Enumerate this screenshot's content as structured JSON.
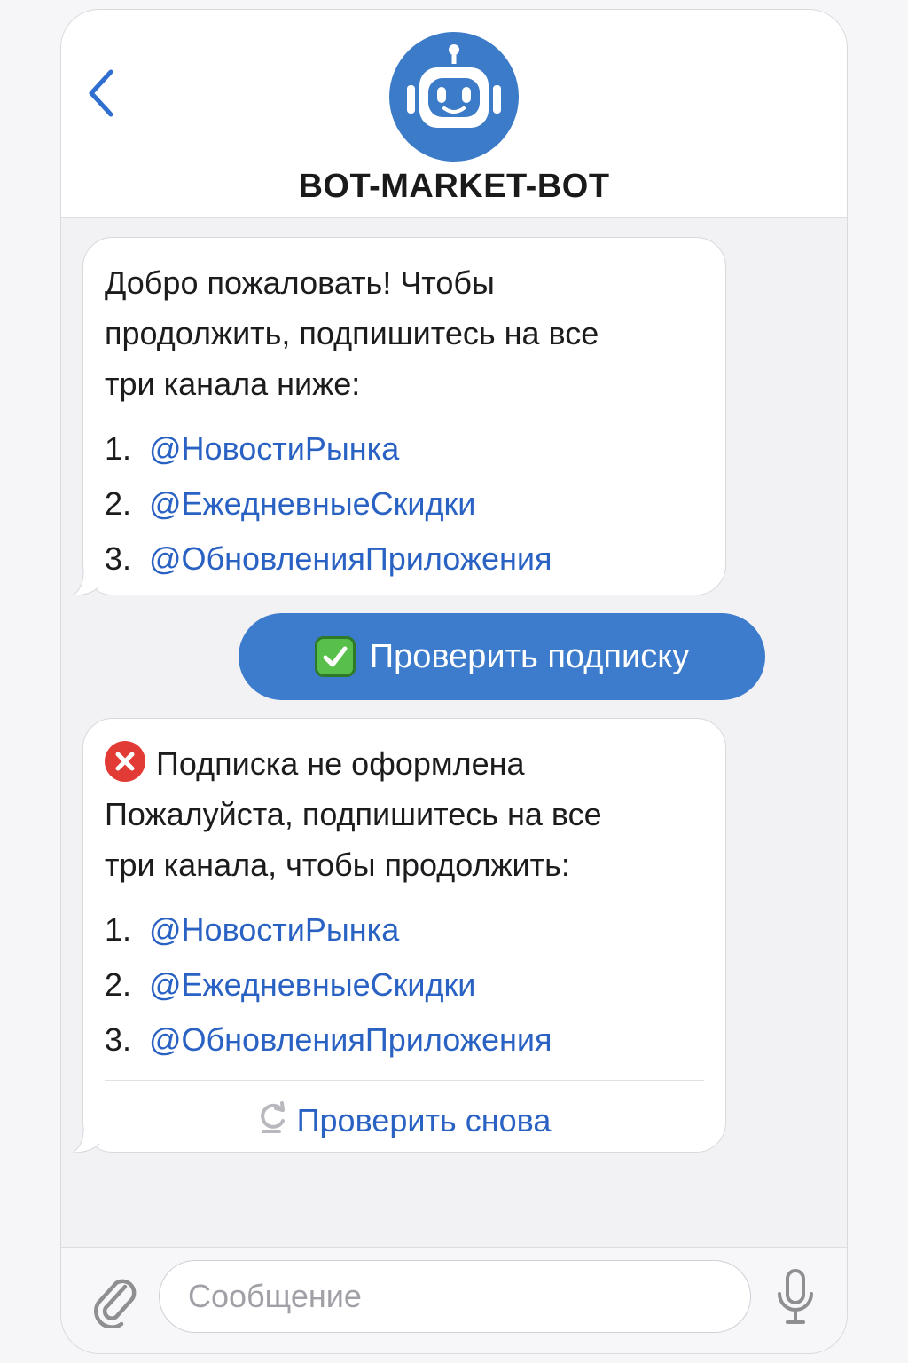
{
  "header": {
    "bot_name": "BOT-MARKET-BOT",
    "back_icon": "chevron-left-icon",
    "avatar_icon": "robot-icon",
    "accent_color": "#3b7bc8"
  },
  "welcome_message": {
    "lines": [
      "Добро пожаловать! Чтобы",
      "продолжить, подпишитесь на все",
      "три канала ниже:"
    ],
    "channels": [
      {
        "num": "1.",
        "name": "@НовостиРынка"
      },
      {
        "num": "2.",
        "name": "@ЕжедневныеСкидки"
      },
      {
        "num": "3.",
        "name": "@ОбновленияПриложения"
      }
    ]
  },
  "check_button": {
    "icon": "check-mark-icon",
    "label": "Проверить подписку"
  },
  "error_message": {
    "icon": "cross-mark-icon",
    "title": "Подписка не оформлена",
    "lines": [
      "Пожалуйста, подпишитесь на все",
      "три канала, чтобы продолжить:"
    ],
    "channels": [
      {
        "num": "1.",
        "name": "@НовостиРынка"
      },
      {
        "num": "2.",
        "name": "@ЕжедневныеСкидки"
      },
      {
        "num": "3.",
        "name": "@ОбновленияПриложения"
      }
    ],
    "retry_icon": "refresh-icon",
    "retry_label": "Проверить снова"
  },
  "input_bar": {
    "placeholder": "Сообщение",
    "value": "",
    "attach_icon": "paperclip-icon",
    "mic_icon": "microphone-icon"
  },
  "colors": {
    "link": "#2a62c3",
    "button_bg": "#3d7ccc",
    "error": "#e23b35",
    "success": "#58c04a"
  }
}
